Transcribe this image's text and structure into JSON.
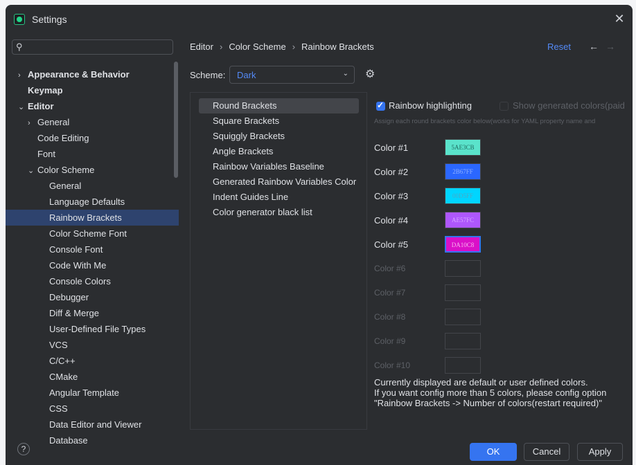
{
  "window": {
    "title": "Settings",
    "close_icon": "close-icon",
    "app_icon": "pycharm-icon"
  },
  "search": {
    "icon": "search-icon",
    "value": ""
  },
  "nav": [
    {
      "label": "Appearance & Behavior",
      "level": 0,
      "chevron": "›",
      "bold": true
    },
    {
      "label": "Keymap",
      "level": 0,
      "chevron": "",
      "bold": true
    },
    {
      "label": "Editor",
      "level": 0,
      "chevron": "⌄",
      "bold": true
    },
    {
      "label": "General",
      "level": 1,
      "chevron": "›"
    },
    {
      "label": "Code Editing",
      "level": 1,
      "chevron": ""
    },
    {
      "label": "Font",
      "level": 1,
      "chevron": ""
    },
    {
      "label": "Color Scheme",
      "level": 1,
      "chevron": "⌄"
    },
    {
      "label": "General",
      "level": 2,
      "chevron": ""
    },
    {
      "label": "Language Defaults",
      "level": 2,
      "chevron": ""
    },
    {
      "label": "Rainbow Brackets",
      "level": 2,
      "chevron": "",
      "selected": true
    },
    {
      "label": "Color Scheme Font",
      "level": 2,
      "chevron": ""
    },
    {
      "label": "Console Font",
      "level": 2,
      "chevron": ""
    },
    {
      "label": "Code With Me",
      "level": 2,
      "chevron": ""
    },
    {
      "label": "Console Colors",
      "level": 2,
      "chevron": ""
    },
    {
      "label": "Debugger",
      "level": 2,
      "chevron": ""
    },
    {
      "label": "Diff & Merge",
      "level": 2,
      "chevron": ""
    },
    {
      "label": "User-Defined File Types",
      "level": 2,
      "chevron": ""
    },
    {
      "label": "VCS",
      "level": 2,
      "chevron": ""
    },
    {
      "label": "C/C++",
      "level": 2,
      "chevron": ""
    },
    {
      "label": "CMake",
      "level": 2,
      "chevron": ""
    },
    {
      "label": "Angular Template",
      "level": 2,
      "chevron": ""
    },
    {
      "label": "CSS",
      "level": 2,
      "chevron": ""
    },
    {
      "label": "Data Editor and Viewer",
      "level": 2,
      "chevron": ""
    },
    {
      "label": "Database",
      "level": 2,
      "chevron": ""
    }
  ],
  "breadcrumb": {
    "items": [
      "Editor",
      "Color Scheme",
      "Rainbow Brackets"
    ],
    "separator": "›"
  },
  "header": {
    "reset_label": "Reset",
    "back": "←",
    "forward": "→"
  },
  "scheme": {
    "label": "Scheme:",
    "value": "Dark",
    "settings_icon": "gear-icon"
  },
  "bracket_list": [
    {
      "label": "Round Brackets",
      "selected": true
    },
    {
      "label": "Square Brackets"
    },
    {
      "label": "Squiggly Brackets"
    },
    {
      "label": "Angle Brackets"
    },
    {
      "label": "Rainbow Variables Baseline"
    },
    {
      "label": "Generated Rainbow Variables Color"
    },
    {
      "label": "Indent Guides Line"
    },
    {
      "label": "Color generator black list"
    }
  ],
  "options": {
    "rainbow_highlighting": {
      "label": "Rainbow highlighting",
      "checked": true
    },
    "show_generated": {
      "label": "Show generated colors(paid",
      "checked": false
    },
    "hint": "Assign each round brackets color below(works for YAML property name and"
  },
  "colors": [
    {
      "label": "Color #1",
      "hex": "5AE3CB",
      "color": "#5ae3cb",
      "text_color": "#1e6b5f",
      "enabled": true
    },
    {
      "label": "Color #2",
      "hex": "2B67FF",
      "color": "#2b67ff",
      "text_color": "#8fb0ff",
      "enabled": true
    },
    {
      "label": "Color #3",
      "hex": "00D5FF",
      "color": "#00d5ff",
      "text_color": "#4aa8c6",
      "enabled": true
    },
    {
      "label": "Color #4",
      "hex": "AE57FC",
      "color": "#ae57fc",
      "text_color": "#d8a8ff",
      "enabled": true
    },
    {
      "label": "Color #5",
      "hex": "DA10C8",
      "color": "#da10c8",
      "text_color": "#f7b3ef",
      "enabled": true,
      "focused": true
    },
    {
      "label": "Color #6",
      "hex": "",
      "enabled": false
    },
    {
      "label": "Color #7",
      "hex": "",
      "enabled": false
    },
    {
      "label": "Color #8",
      "hex": "",
      "enabled": false
    },
    {
      "label": "Color #9",
      "hex": "",
      "enabled": false
    },
    {
      "label": "Color #10",
      "hex": "",
      "enabled": false
    }
  ],
  "note": {
    "line1": "Currently displayed are default or user defined colors.",
    "line2": "If you want config more than 5 colors, please config option",
    "line3": "\"Rainbow Brackets -> Number of colors(restart required)\""
  },
  "footer": {
    "help_label": "?",
    "ok_label": "OK",
    "cancel_label": "Cancel",
    "apply_label": "Apply"
  }
}
